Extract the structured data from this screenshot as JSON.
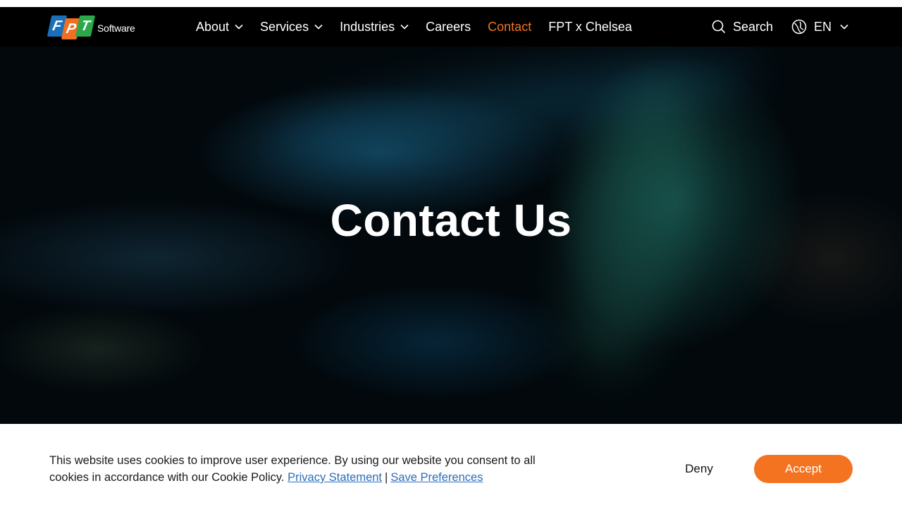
{
  "brand": {
    "logo_letters": [
      "F",
      "P",
      "T"
    ],
    "logo_word": "Software",
    "colors": {
      "blue": "#1b6fb8",
      "orange": "#f26f21",
      "green": "#2aa84a"
    }
  },
  "nav": {
    "items": [
      {
        "label": "About",
        "has_dropdown": true
      },
      {
        "label": "Services",
        "has_dropdown": true
      },
      {
        "label": "Industries",
        "has_dropdown": true
      },
      {
        "label": "Careers",
        "has_dropdown": false
      },
      {
        "label": "Contact",
        "has_dropdown": false,
        "active": true
      },
      {
        "label": "FPT x Chelsea",
        "has_dropdown": false
      }
    ],
    "search_label": "Search",
    "search_icon": "search-icon",
    "language": "EN",
    "language_icon": "globe-icon",
    "active_color": "#f37321"
  },
  "hero": {
    "title": "Contact Us"
  },
  "cookie": {
    "text": "This website uses cookies to improve user experience. By using our website you consent to all cookies in accordance with our Cookie Policy.",
    "privacy_link": "Privacy Statement",
    "separator": "|",
    "preferences_link": "Save Preferences",
    "deny_label": "Deny",
    "accept_label": "Accept",
    "accept_color": "#f37321"
  }
}
